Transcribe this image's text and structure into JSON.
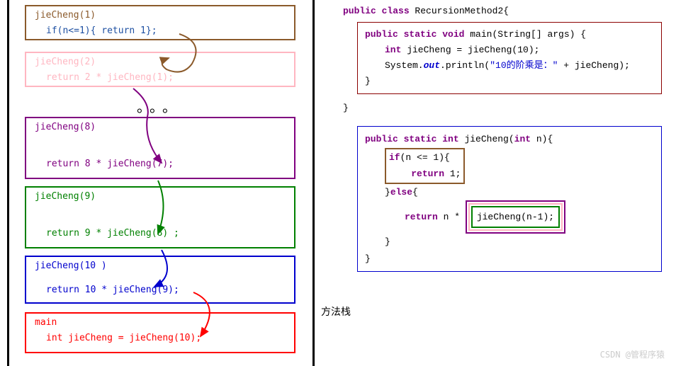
{
  "stack": {
    "frame1": {
      "header": "jieCheng(1)",
      "body": "if(n<=1){  return 1};"
    },
    "frame2": {
      "header": "jieCheng(2)",
      "body": "return  2 * jieCheng(1);"
    },
    "dots": "。。。",
    "frame8": {
      "header": "jieCheng(8)",
      "body": "return 8 * jieCheng(7);"
    },
    "frame9": {
      "header": "jieCheng(9)",
      "body": "return 9 * jieCheng(8) ;"
    },
    "frame10": {
      "header": "jieCheng(10 )",
      "body": "return 10 * jieCheng(9);"
    },
    "frameMain": {
      "header": "main",
      "body": "int jieCheng =   jieCheng(10);"
    },
    "label": "方法栈"
  },
  "code_main": {
    "class_line_pre": "public class",
    "class_name": " RecursionMethod2{",
    "line1_pre": "public static void",
    "line1_post": " main(String[] args) {",
    "line2_pre": "int",
    "line2_mid": " jieCheng =   jieCheng(10);",
    "line3_pre": "System.",
    "line3_out": "out",
    "line3_mid": ".println(",
    "line3_str": "\"10的阶乘是：\"",
    "line3_post": " + jieCheng);",
    "close1": "}",
    "close2": "}"
  },
  "code_method": {
    "line1_pre": "public static",
    "line1_mid": "   int",
    "line1_post": " jieCheng(",
    "line1_int": "int",
    "line1_end": " n){",
    "if_pre": "if",
    "if_cond": "(n <= 1){",
    "return1_pre": "return",
    "return1_val": " 1;",
    "else_pre": "}",
    "else_kw": "else",
    "else_post": "{",
    "return2_pre": "return",
    "return2_mid": " n * ",
    "return2_call": "jieCheng(n-1);",
    "close1": "}",
    "close2": "}",
    "close3": "}"
  },
  "watermark": "CSDN @管程序猿"
}
